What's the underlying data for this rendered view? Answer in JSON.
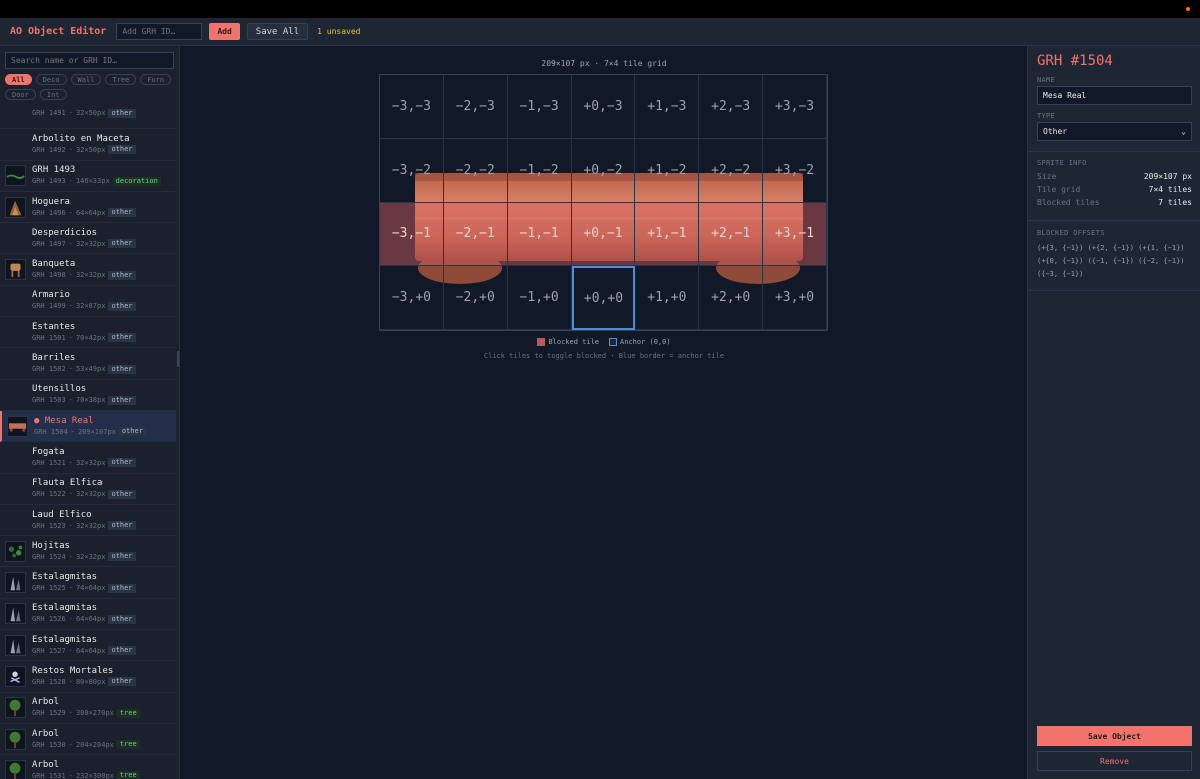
{
  "header": {
    "title": "AO Object Editor",
    "grh_placeholder": "Add GRH ID…",
    "add_label": "Add",
    "save_all_label": "Save All",
    "unsaved_text": "1 unsaved"
  },
  "sidebar": {
    "search_placeholder": "Search name or GRH ID…",
    "filters": [
      "All",
      "Deco",
      "Wall",
      "Tree",
      "Furn",
      "Door",
      "Int"
    ],
    "active_filter": "All",
    "items": [
      {
        "name": "",
        "grh": "GRH 1491",
        "size": "32×50px",
        "tag": "other",
        "thumb": ""
      },
      {
        "name": "Arbolito en Maceta",
        "grh": "GRH 1492",
        "size": "32×50px",
        "tag": "other",
        "thumb": ""
      },
      {
        "name": "GRH 1493",
        "grh": "GRH 1493",
        "size": "146×33px",
        "tag": "decoration",
        "thumb": "grass-thumb"
      },
      {
        "name": "Hoguera",
        "grh": "GRH 1496",
        "size": "64×64px",
        "tag": "other",
        "thumb": "campfire-thumb"
      },
      {
        "name": "Desperdicios",
        "grh": "GRH 1497",
        "size": "32×32px",
        "tag": "other",
        "thumb": ""
      },
      {
        "name": "Banqueta",
        "grh": "GRH 1498",
        "size": "32×32px",
        "tag": "other",
        "thumb": "stool-thumb"
      },
      {
        "name": "Armario",
        "grh": "GRH 1499",
        "size": "32×87px",
        "tag": "other",
        "thumb": ""
      },
      {
        "name": "Estantes",
        "grh": "GRH 1501",
        "size": "70×42px",
        "tag": "other",
        "thumb": ""
      },
      {
        "name": "Barriles",
        "grh": "GRH 1502",
        "size": "53×49px",
        "tag": "other",
        "thumb": ""
      },
      {
        "name": "Utensillos",
        "grh": "GRH 1503",
        "size": "70×38px",
        "tag": "other",
        "thumb": ""
      },
      {
        "name": "● Mesa Real",
        "grh": "GRH 1504",
        "size": "209×107px",
        "tag": "other",
        "thumb": "table-thumb",
        "selected": true
      },
      {
        "name": "Fogata",
        "grh": "GRH 1521",
        "size": "32×32px",
        "tag": "other",
        "thumb": ""
      },
      {
        "name": "Flauta Elfica",
        "grh": "GRH 1522",
        "size": "32×32px",
        "tag": "other",
        "thumb": ""
      },
      {
        "name": "Laud Elfico",
        "grh": "GRH 1523",
        "size": "32×32px",
        "tag": "other",
        "thumb": ""
      },
      {
        "name": "Hojitas",
        "grh": "GRH 1524",
        "size": "32×32px",
        "tag": "other",
        "thumb": "leaves-thumb"
      },
      {
        "name": "Estalagmitas",
        "grh": "GRH 1525",
        "size": "74×64px",
        "tag": "other",
        "thumb": "stalagmite-thumb"
      },
      {
        "name": "Estalagmitas",
        "grh": "GRH 1526",
        "size": "64×64px",
        "tag": "other",
        "thumb": "stalagmite-thumb"
      },
      {
        "name": "Estalagmitas",
        "grh": "GRH 1527",
        "size": "64×64px",
        "tag": "other",
        "thumb": "stalagmite-thumb"
      },
      {
        "name": "Restos Mortales",
        "grh": "GRH 1528",
        "size": "80×80px",
        "tag": "other",
        "thumb": "remains-thumb"
      },
      {
        "name": "Arbol",
        "grh": "GRH 1529",
        "size": "300×270px",
        "tag": "tree",
        "thumb": "tree-thumb"
      },
      {
        "name": "Arbol",
        "grh": "GRH 1530",
        "size": "204×204px",
        "tag": "tree",
        "thumb": "tree-thumb"
      },
      {
        "name": "Arbol",
        "grh": "GRH 1531",
        "size": "232×300px",
        "tag": "tree",
        "thumb": "tree-thumb"
      }
    ]
  },
  "canvas": {
    "caption": "209×107 px · 7×4 tile grid",
    "cols": 7,
    "rows": 4,
    "blocked": [
      "+3,-1",
      "+2,-1",
      "+1,-1",
      "+0,-1",
      "-1,-1",
      "-2,-1",
      "-3,-1"
    ],
    "anchor": "+0,+0",
    "legend_blocked": "Blocked tile",
    "legend_anchor": "Anchor (0,0)",
    "hint": "Click tiles to toggle blocked · Blue border = anchor tile"
  },
  "panel": {
    "title": "GRH #1504",
    "name_label": "NAME",
    "name_value": "Mesa Real",
    "type_label": "TYPE",
    "type_value": "Other",
    "sprite_info_label": "SPRITE INFO",
    "size_label": "Size",
    "size_value": "209×107 px",
    "tile_grid_label": "Tile grid",
    "tile_grid_value": "7×4 tiles",
    "blocked_label": "Blocked tiles",
    "blocked_value": "7 tiles",
    "offsets_label": "BLOCKED OFFSETS",
    "offsets_text": "(+{3, {−1}) (+{2, {−1}) (+{1, {−1}) (+{0, {−1}) ({−1, {−1}) ({−2, {−1}) ({−3, {−1})",
    "save_label": "Save Object",
    "remove_label": "Remove"
  },
  "colors": {
    "accent": "#f2736b",
    "anchor": "#4b8fd6",
    "tag_green": "#4ade80",
    "unsaved": "#e6c229"
  }
}
